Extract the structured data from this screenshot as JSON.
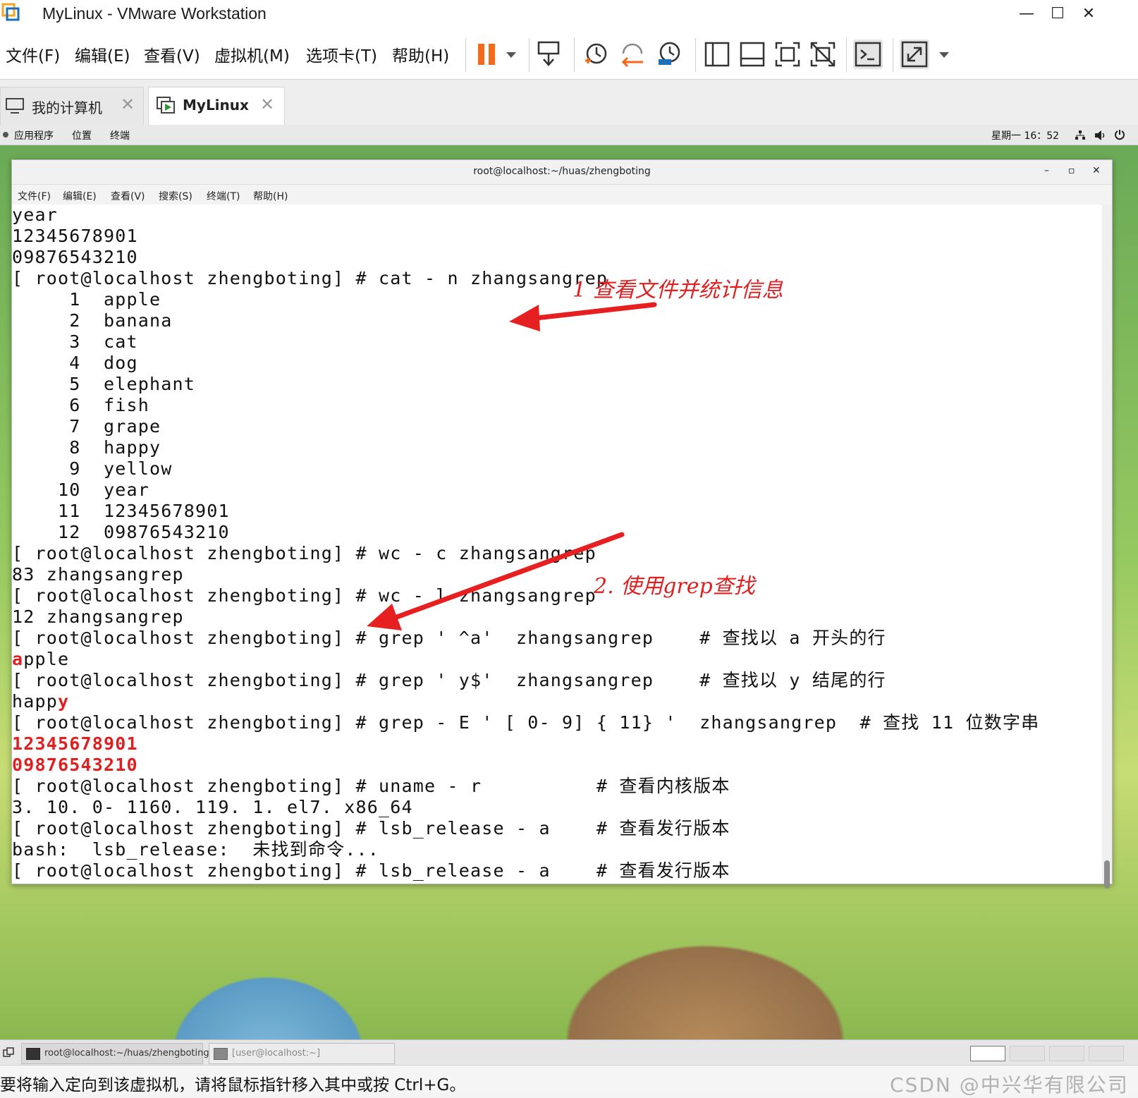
{
  "window": {
    "title": "MyLinux - VMware Workstation",
    "minimize": "—",
    "maximize": "☐",
    "close": "✕"
  },
  "menubar": {
    "items": [
      "文件(F)",
      "编辑(E)",
      "查看(V)",
      "虚拟机(M)",
      "选项卡(T)",
      "帮助(H)"
    ]
  },
  "toolbar": {
    "icons": [
      "pause-icon",
      "dropdown-arrow-icon",
      "send-ctrl-alt-del-icon",
      "snapshot-take-icon",
      "snapshot-revert-icon",
      "snapshot-manager-icon",
      "library-icon",
      "thumbnail-bar-icon",
      "fullscreen-icon",
      "unity-icon",
      "console-view-icon",
      "stretch-icon"
    ]
  },
  "tabs": [
    {
      "label": "我的计算机",
      "close": "✕"
    },
    {
      "label": "MyLinux",
      "close": "✕"
    }
  ],
  "gnome": {
    "apps": "应用程序",
    "places": "位置",
    "terminal": "终端",
    "clock": "星期一 16：52"
  },
  "terminal": {
    "title": "root@localhost:~/huas/zhengboting",
    "min": "–",
    "max": "▫",
    "close": "✕",
    "menu": [
      "文件(F)",
      "编辑(E)",
      "查看(V)",
      "搜索(S)",
      "终端(T)",
      "帮助(H)"
    ],
    "lines": [
      "year",
      "12345678901",
      "09876543210",
      "[ root@localhost zhengboting] # cat - n zhangsangrep",
      "     1  apple",
      "     2  banana",
      "     3  cat",
      "     4  dog",
      "     5  elephant",
      "     6  fish",
      "     7  grape",
      "     8  happy",
      "     9  yellow",
      "    10  year",
      "    11  12345678901",
      "    12  09876543210",
      "[ root@localhost zhengboting] # wc - c zhangsangrep",
      "83 zhangsangrep",
      "[ root@localhost zhengboting] # wc - l zhangsangrep",
      "12 zhangsangrep",
      "[ root@localhost zhengboting] # grep ' ^a'  zhangsangrep    # 查找以 a 开头的行",
      "",
      "[ root@localhost zhengboting] # grep ' y$'  zhangsangrep    # 查找以 y 结尾的行",
      "",
      "[ root@localhost zhengboting] # grep - E ' [ 0- 9] { 11} '  zhangsangrep  # 查找 11 位数字串",
      "12345678901",
      "09876543210",
      "[ root@localhost zhengboting] # uname - r          # 查看内核版本",
      "3. 10. 0- 1160. 119. 1. el7. x86_64",
      "[ root@localhost zhengboting] # lsb_release - a    # 查看发行版本",
      "bash:  lsb_release:  未找到命令...",
      "[ root@localhost zhengboting] # lsb_release - a    # 查看发行版本"
    ],
    "match_apple_hl": "a",
    "match_apple_rest": "pple",
    "match_happy_rest": "happ",
    "match_happy_hl": "y"
  },
  "annotations": {
    "note1": "1  查看文件并统计信息",
    "note2": "2. 使用grep查找"
  },
  "taskbar": {
    "items": [
      "root@localhost:~/huas/zhengboting",
      "[user@localhost:~]"
    ]
  },
  "statusbar": {
    "hint": "要将输入定向到该虚拟机，请将鼠标指针移入其中或按 Ctrl+G。",
    "watermark": "CSDN @中兴华有限公司"
  },
  "colors": {
    "accent_orange": "#f26a1b",
    "highlight_red": "#e02020"
  }
}
